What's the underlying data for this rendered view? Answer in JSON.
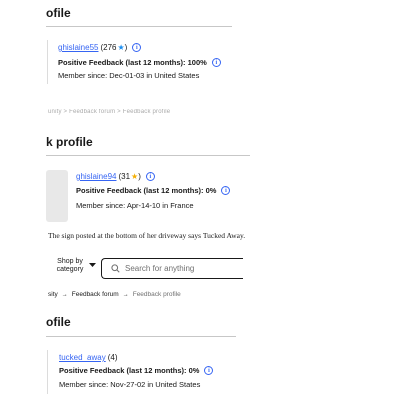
{
  "sections": [
    {
      "heading": "ofile",
      "username": "ghislaine55",
      "score": "(276",
      "star_color": "#1c8ef0",
      "score_close": ")",
      "positive_feedback": "Positive Feedback (last 12 months): 100%",
      "member_since": "Member since: Dec-01-03 in United States"
    },
    {
      "heading": "k profile",
      "username": "ghislaine94",
      "score": "(31",
      "star_color": "#f5af02",
      "score_close": ")",
      "positive_feedback": "Positive Feedback (last 12 months): 0%",
      "member_since": "Member since: Apr-14-10 in France"
    },
    {
      "heading": "ofile",
      "username": "tucked_away",
      "score": "(4)",
      "star_color": "",
      "score_close": "",
      "positive_feedback": "Positive Feedback (last 12 months): 0%",
      "member_since": "Member since: Nov-27-02 in United States"
    }
  ],
  "cut_breadcrumb_fragment": "unity  >  Feedback forum  >  Feedback profile",
  "caption": "The sign posted at the bottom of her driveway says Tucked Away.",
  "search": {
    "shop_by_category": "Shop by category",
    "placeholder": "Search for anything"
  },
  "breadcrumb": {
    "first": "sity",
    "second": "Feedback forum",
    "current": "Feedback profile"
  },
  "icons": {
    "info": "info-icon",
    "star": "star-icon",
    "search": "search-icon",
    "chevron": "chevron-down-icon",
    "avatar": "avatar-placeholder"
  }
}
